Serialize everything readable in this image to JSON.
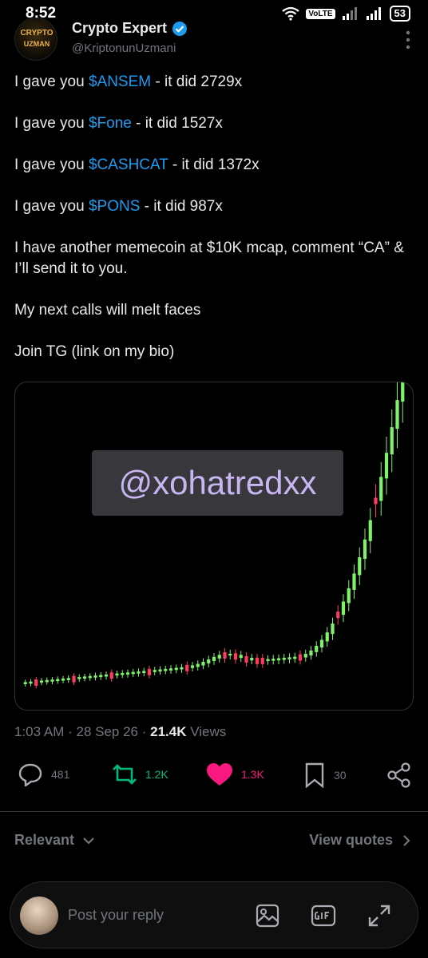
{
  "status_bar": {
    "time": "8:52",
    "network": "VoLTE",
    "battery": "53"
  },
  "author": {
    "name": "Crypto Expert",
    "handle": "@KriptonunUzmani",
    "avatar_text_line1": "CRYPTO",
    "avatar_text_line2": "UZMAN"
  },
  "tweet": {
    "lines": [
      {
        "prefix": "I gave you ",
        "ticker": "$ANSEM",
        "suffix": " - it did 2729x"
      },
      {
        "prefix": "I gave you ",
        "ticker": "$Fone",
        "suffix": " - it did 1527x"
      },
      {
        "prefix": "I gave you ",
        "ticker": "$CASHCAT",
        "suffix": " - it did 1372x"
      },
      {
        "prefix": "I gave you ",
        "ticker": "$PONS",
        "suffix": " - it did 987x"
      }
    ],
    "paragraph_ca": "I have another memecoin at $10K mcap, comment “CA” & I’ll send it to you.",
    "paragraph_melt": "My next calls will melt faces",
    "paragraph_tg": "Join TG (link on my bio)"
  },
  "media": {
    "watermark": "@xohatredxx",
    "up_color": "#7ff26a",
    "down_color": "#ff3b5c"
  },
  "meta": {
    "time": "1:03 AM",
    "date": "28 Sep 26",
    "views_count": "21.4K",
    "views_label": "Views"
  },
  "actions": {
    "replies": "481",
    "reposts": "1.2K",
    "likes": "1.3K",
    "bookmarks": "30",
    "repost_color": "#00ba7c",
    "like_color": "#f91880"
  },
  "sort": {
    "label": "Relevant",
    "view_quotes": "View quotes"
  },
  "reply": {
    "placeholder": "Post your reply"
  }
}
